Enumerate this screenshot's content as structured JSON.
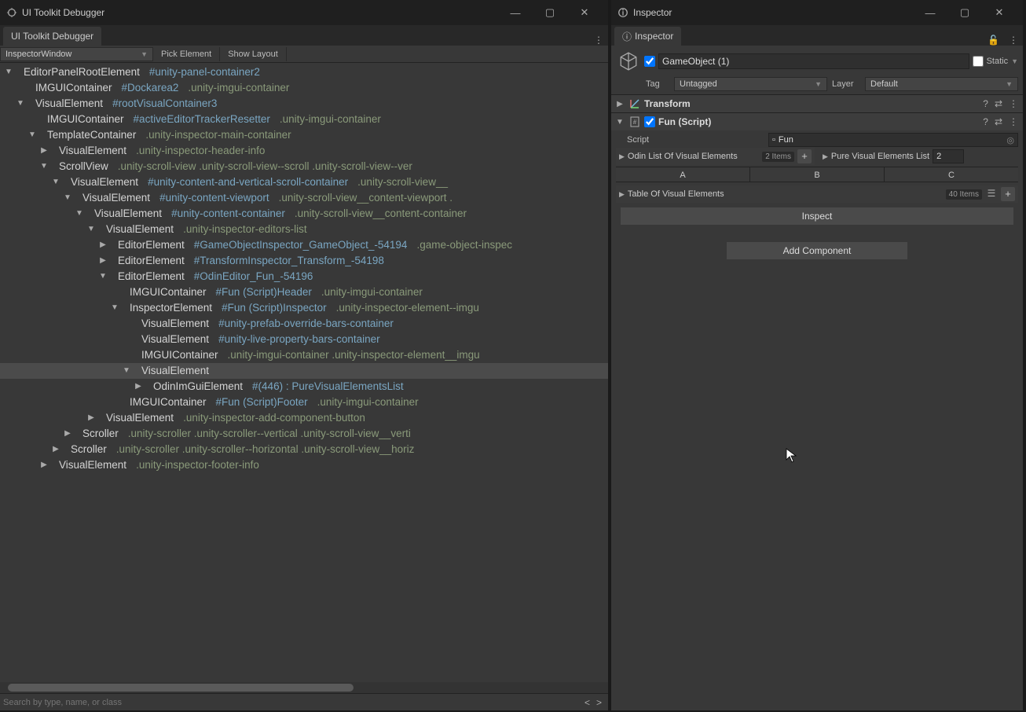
{
  "debugger": {
    "title": "UI Toolkit Debugger",
    "tab": "UI Toolkit Debugger",
    "dropdown": "InspectorWindow",
    "pick": "Pick Element",
    "show_layout": "Show Layout",
    "search_placeholder": "Search by type, name, or class",
    "nav_prev": "<",
    "nav_next": ">",
    "tree": [
      {
        "d": 0,
        "f": "open",
        "n": "EditorPanelRootElement",
        "id": "#unity-panel-container2"
      },
      {
        "d": 1,
        "f": "none",
        "n": "IMGUIContainer",
        "id": "#Dockarea2",
        "cls": ".unity-imgui-container"
      },
      {
        "d": 1,
        "f": "open",
        "n": "VisualElement",
        "id": "#rootVisualContainer3"
      },
      {
        "d": 2,
        "f": "none",
        "n": "IMGUIContainer",
        "id": "#activeEditorTrackerResetter",
        "cls": ".unity-imgui-container"
      },
      {
        "d": 2,
        "f": "open",
        "n": "TemplateContainer",
        "cls": ".unity-inspector-main-container"
      },
      {
        "d": 3,
        "f": "closed",
        "n": "VisualElement",
        "cls": ".unity-inspector-header-info"
      },
      {
        "d": 3,
        "f": "open",
        "n": "ScrollView",
        "cls": ".unity-scroll-view  .unity-scroll-view--scroll  .unity-scroll-view--ver"
      },
      {
        "d": 4,
        "f": "open",
        "n": "VisualElement",
        "id": "#unity-content-and-vertical-scroll-container",
        "cls": ".unity-scroll-view__"
      },
      {
        "d": 5,
        "f": "open",
        "n": "VisualElement",
        "id": "#unity-content-viewport",
        "cls": ".unity-scroll-view__content-viewport  ."
      },
      {
        "d": 6,
        "f": "open",
        "n": "VisualElement",
        "id": "#unity-content-container",
        "cls": ".unity-scroll-view__content-container"
      },
      {
        "d": 7,
        "f": "open",
        "n": "VisualElement",
        "cls": ".unity-inspector-editors-list"
      },
      {
        "d": 8,
        "f": "closed",
        "n": "EditorElement",
        "id": "#GameObjectInspector_GameObject_-54194",
        "cls": ".game-object-inspec"
      },
      {
        "d": 8,
        "f": "closed",
        "n": "EditorElement",
        "id": "#TransformInspector_Transform_-54198"
      },
      {
        "d": 8,
        "f": "open",
        "n": "EditorElement",
        "id": "#OdinEditor_Fun_-54196"
      },
      {
        "d": 9,
        "f": "none",
        "n": "IMGUIContainer",
        "id": "#Fun (Script)Header",
        "cls": ".unity-imgui-container"
      },
      {
        "d": 9,
        "f": "open",
        "n": "InspectorElement",
        "id": "#Fun (Script)Inspector",
        "cls": ".unity-inspector-element--imgu"
      },
      {
        "d": 10,
        "f": "none",
        "n": "VisualElement",
        "id": "#unity-prefab-override-bars-container"
      },
      {
        "d": 10,
        "f": "none",
        "n": "VisualElement",
        "id": "#unity-live-property-bars-container"
      },
      {
        "d": 10,
        "f": "none",
        "n": "IMGUIContainer",
        "cls": ".unity-imgui-container  .unity-inspector-element__imgu"
      },
      {
        "d": 10,
        "f": "open",
        "n": "VisualElement",
        "sel": true
      },
      {
        "d": 11,
        "f": "closed",
        "n": "OdinImGuiElement",
        "id": "#(446) : PureVisualElementsList"
      },
      {
        "d": 9,
        "f": "none",
        "n": "IMGUIContainer",
        "id": "#Fun (Script)Footer",
        "cls": ".unity-imgui-container"
      },
      {
        "d": 7,
        "f": "closed",
        "n": "VisualElement",
        "cls": ".unity-inspector-add-component-button"
      },
      {
        "d": 5,
        "f": "closed",
        "n": "Scroller",
        "cls": ".unity-scroller  .unity-scroller--vertical  .unity-scroll-view__verti"
      },
      {
        "d": 4,
        "f": "closed",
        "n": "Scroller",
        "cls": ".unity-scroller  .unity-scroller--horizontal  .unity-scroll-view__horiz"
      },
      {
        "d": 3,
        "f": "closed",
        "n": "VisualElement",
        "cls": ".unity-inspector-footer-info"
      }
    ]
  },
  "inspector": {
    "title": "Inspector",
    "tab": "Inspector",
    "go_name": "GameObject (1)",
    "static_lbl": "Static",
    "tag_lbl": "Tag",
    "tag_val": "Untagged",
    "layer_lbl": "Layer",
    "layer_val": "Default",
    "transform": "Transform",
    "fun": "Fun (Script)",
    "script_lbl": "Script",
    "script_val": "Fun",
    "odin_list": "Odin List Of Visual Elements",
    "odin_count": "2 Items",
    "pure_list": "Pure Visual Elements List",
    "pure_count": "2",
    "col_a": "A",
    "col_b": "B",
    "col_c": "C",
    "table_lbl": "Table Of Visual Elements",
    "table_count": "40 Items",
    "inspect_btn": "Inspect",
    "add_comp": "Add Component"
  }
}
